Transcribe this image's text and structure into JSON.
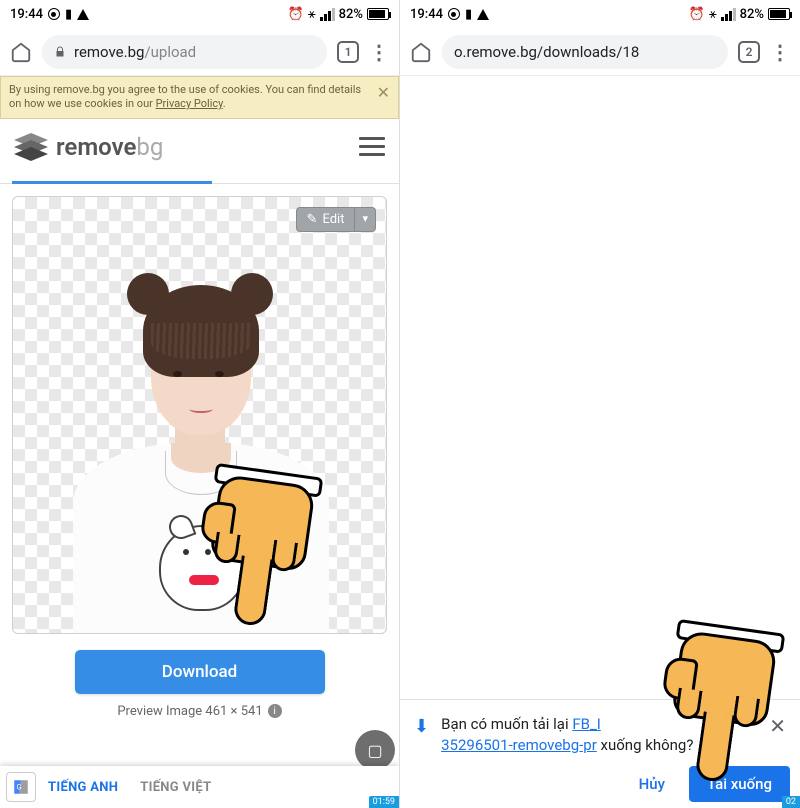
{
  "left": {
    "status": {
      "time": "19:44",
      "battery": "82%"
    },
    "chrome": {
      "url_host": "remove.bg",
      "url_path": "/upload",
      "tab_count": "1"
    },
    "cookie": {
      "text": "By using remove.bg you agree to the use of cookies. You can find details on how we use cookies in our ",
      "link": "Privacy Policy",
      "tail": "."
    },
    "logo": {
      "part1": "remove",
      "part2": "bg"
    },
    "edit_label": "Edit",
    "download_label": "Download",
    "preview_label": "Preview Image 461 × 541",
    "translate": {
      "lang1": "TIẾNG ANH",
      "lang2": "TIẾNG VIỆT"
    },
    "timecode": "01:59"
  },
  "right": {
    "status": {
      "time": "19:44",
      "battery": "82%"
    },
    "chrome": {
      "url_full": "o.remove.bg/downloads/18",
      "tab_count": "2"
    },
    "prompt": {
      "pre": "Bạn có muốn tải lại ",
      "link1": "FB_I",
      "link2": "35296501-removebg-pr",
      "post": " xuống không?",
      "cancel": "Hủy",
      "download": "Tải xuống"
    },
    "timecode": "02"
  }
}
